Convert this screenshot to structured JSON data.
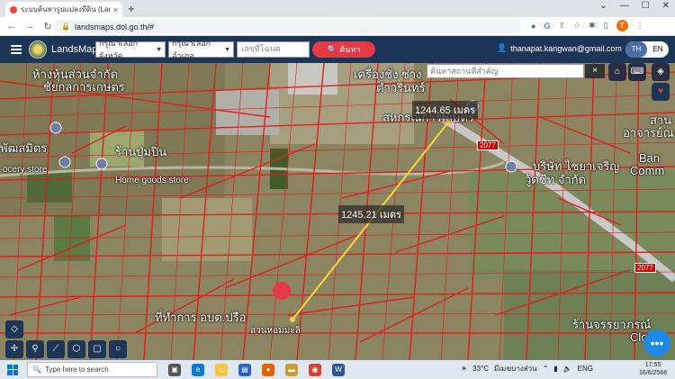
{
  "browser": {
    "tab_title": "ระบบค้นหารูปแปลงที่ดิน (LandsMaps)",
    "tab_close": "×",
    "new_tab": "+",
    "url": "landsmaps.dol.go.th/#",
    "profile_initial": "T"
  },
  "app": {
    "brand": "LandsMaps",
    "province_select": "กรุณาเลือกจังหวัด",
    "amphoe_select": "กรุณาเลือกอำเภอ",
    "parcel_placeholder": "เลขที่โฉนด",
    "search_button": "ค้นหา",
    "user_email": "thanapat.kangwan@gmail.com",
    "lang_th": "TH",
    "lang_en": "EN"
  },
  "map": {
    "search_placeholder": "ค้นหาสถานที่สำคัญ",
    "search_close": "×",
    "measure_1": "1244.65 เมตร",
    "measure_2": "1245.21 เมตร",
    "labels": {
      "company_top_left": "ห้างหุ้นส่วนจำกัด",
      "company_top_left_2": "ชัยกลการเกษตร",
      "store_left": "พัฒสมิตร",
      "store_left_2": "ocery store",
      "store_mid": "ร้านปุ่มปิ่น",
      "store_mid_2": "Home goods store",
      "top_center": "เครื่องชั่ง ช่าง",
      "top_center_2": "ต่ำวรินทร์",
      "coop": "สหกรณ์การเกษตร",
      "company_right": "บริษัท ไชยาเจริญ",
      "company_right_2": "วู้ดชีท จำกัด",
      "far_right_1": "สาน",
      "far_right_2": "อาจารย์ณ",
      "far_right_3": "Ban",
      "far_right_4": "Comm",
      "bottom_office": "ที่ทำการ อบต.ปรือ",
      "bottom_sub": "สวนหอมมะลิ",
      "bottom_right": "ร้านจรรยาภรณ์",
      "bottom_right_2": "Clot"
    },
    "route_1": "2077",
    "route_2": "2077"
  },
  "taskbar": {
    "search_placeholder": "Type here to search",
    "weather": "33°C",
    "weather_desc": "มีเมฆบางส่วน",
    "lang": "ENG",
    "time": "17:55",
    "date": "16/6/2566"
  }
}
